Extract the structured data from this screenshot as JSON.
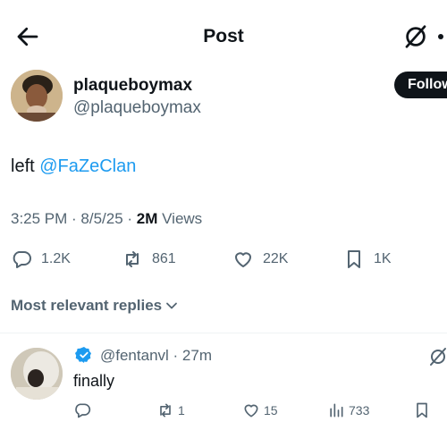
{
  "header": {
    "title": "Post"
  },
  "post": {
    "display_name": "plaqueboymax",
    "handle": "@plaqueboymax",
    "follow_label": "Follow",
    "text": "left ",
    "mention": "@FaZeClan",
    "timestamp": "3:25 PM · 8/5/25 · ",
    "views_count": "2M",
    "views_label": " Views",
    "stats": {
      "replies": "1.2K",
      "reposts": "861",
      "likes": "22K",
      "bookmarks": "1K"
    }
  },
  "replies_section": {
    "sort_label": "Most relevant replies"
  },
  "reply": {
    "handle_time": "@fentanvl · 27m",
    "text": "finally",
    "stats": {
      "reposts": "1",
      "likes": "15",
      "views": "733"
    }
  },
  "colors": {
    "accent": "#1d9bf0",
    "muted": "#536471",
    "text": "#0f1419"
  },
  "icons": [
    "back-arrow-icon",
    "grok-icon",
    "more-icon",
    "reply-icon",
    "repost-icon",
    "like-icon",
    "bookmark-icon",
    "chevron-down-icon",
    "verified-icon",
    "views-icon"
  ]
}
